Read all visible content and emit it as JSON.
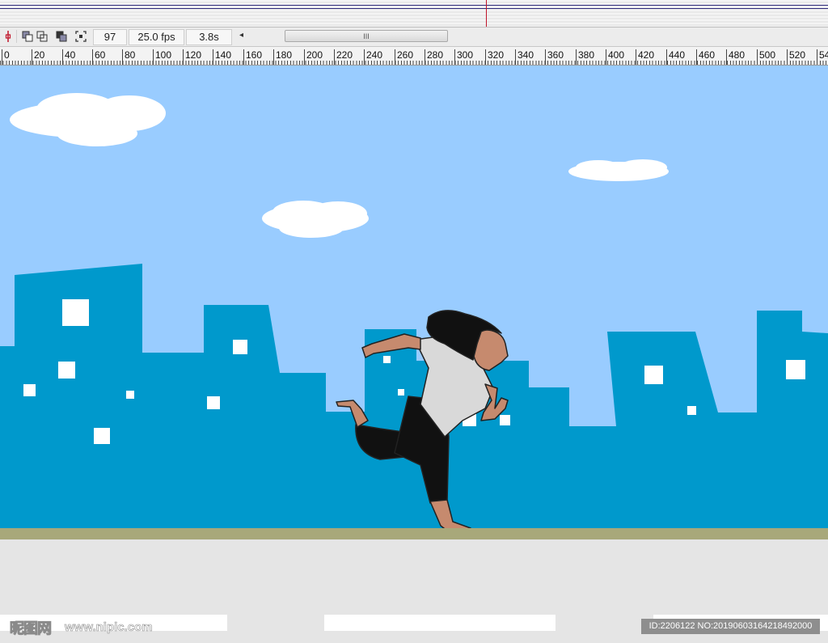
{
  "toolbar": {
    "current_frame": "97",
    "frame_rate": "25.0 fps",
    "elapsed_time": "3.8s",
    "scroll_thumb_grip": "III",
    "scroll_left_arrow": "◂"
  },
  "ruler": {
    "labels": [
      "0",
      "20",
      "40",
      "60",
      "80",
      "100",
      "120",
      "140",
      "160",
      "180",
      "200",
      "220",
      "240",
      "260",
      "280",
      "300",
      "320",
      "340",
      "360",
      "380",
      "400",
      "420",
      "440",
      "460",
      "480",
      "500",
      "520",
      "54"
    ]
  },
  "watermark": {
    "site_logo": "昵图网",
    "site_url": "www.nipic.com",
    "image_id": "ID:2206122 NO:20190603164218492000"
  },
  "colors": {
    "sky": "#99ccff",
    "buildings": "#0099cc",
    "windows": "#ffffff",
    "ground_strip": "#a8a87a",
    "road": "#e5e5e5",
    "shirt": "#d9d9d9",
    "pants": "#111111",
    "skin": "#c68a6e",
    "hair": "#111111"
  },
  "icons": [
    "onion-skin-toggle-icon",
    "onion-skin-icon",
    "onion-skin-outlines-icon",
    "edit-multiple-frames-icon",
    "modify-markers-icon"
  ]
}
